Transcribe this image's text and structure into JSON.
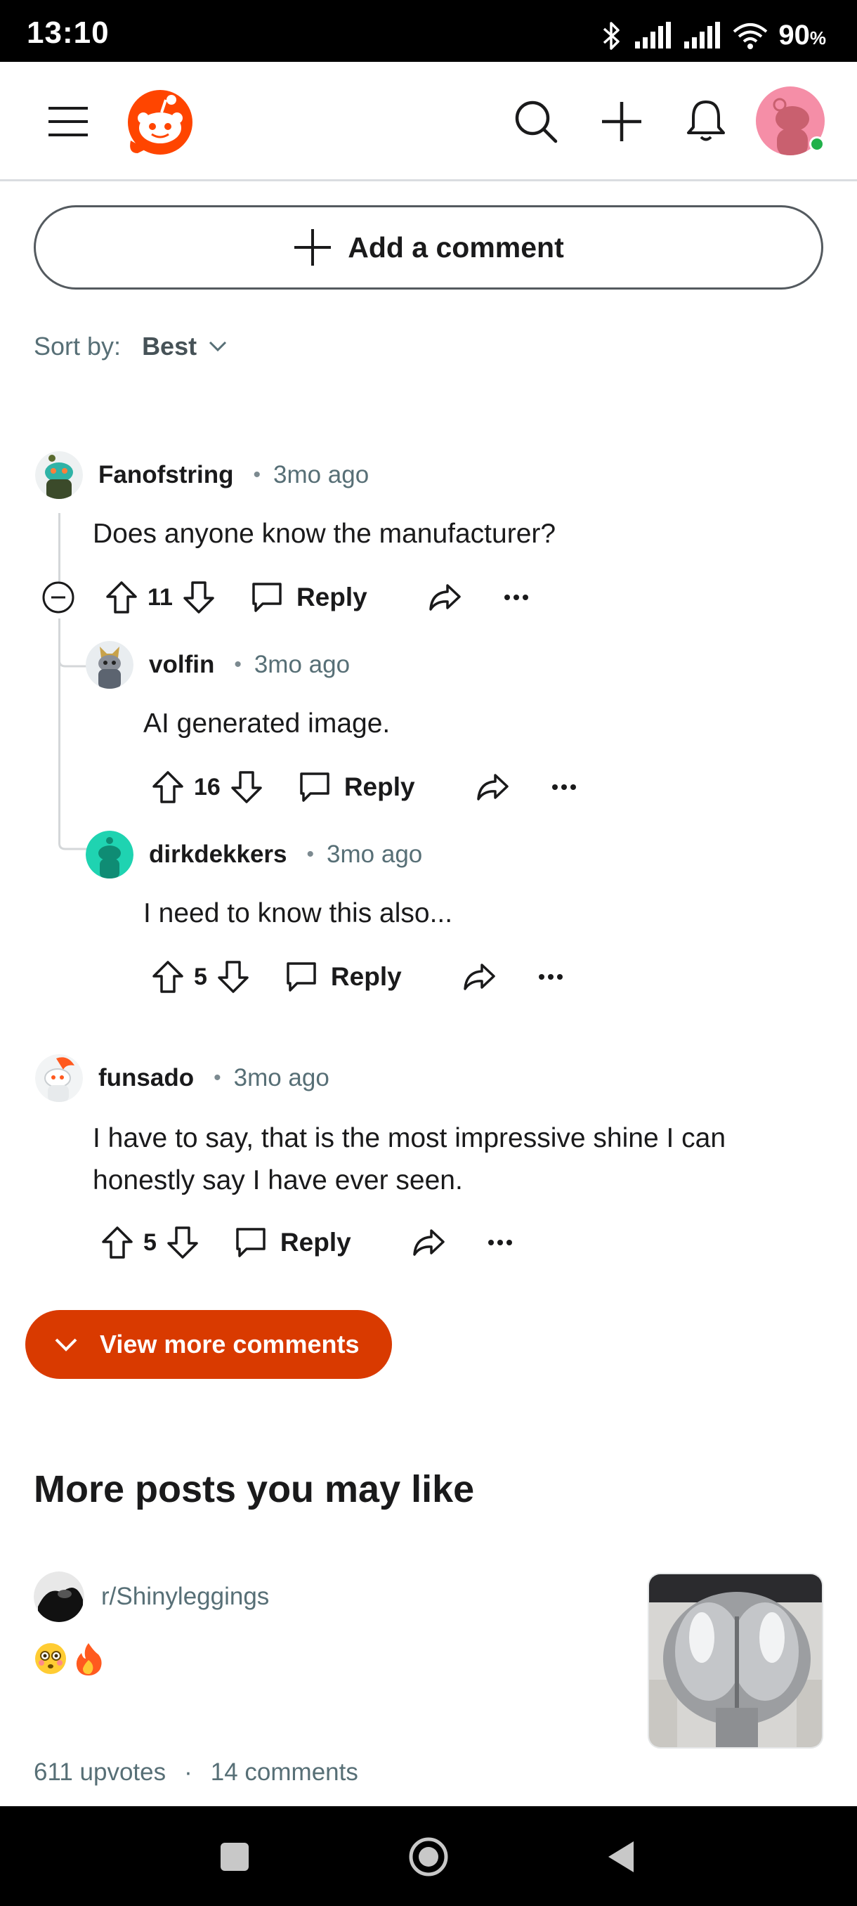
{
  "status_bar": {
    "time": "13:10",
    "battery": "90",
    "battery_unit": "%"
  },
  "header": {
    "menu_icon": "menu-icon",
    "logo": "reddit-logo",
    "search_icon": "search-icon",
    "create_icon": "plus-icon",
    "notifications_icon": "bell-icon"
  },
  "add_comment": {
    "label": "Add a comment"
  },
  "sort": {
    "label": "Sort by:",
    "value": "Best"
  },
  "comments": [
    {
      "author": "Fanofstring",
      "time": "3mo ago",
      "body": "Does anyone know the manufacturer?",
      "votes": "11",
      "reply": "Reply"
    },
    {
      "author": "volfin",
      "time": "3mo ago",
      "body": "AI generated image.",
      "votes": "16",
      "reply": "Reply"
    },
    {
      "author": "dirkdekkers",
      "time": "3mo ago",
      "body": "I need to know this also...",
      "votes": "5",
      "reply": "Reply"
    },
    {
      "author": "funsado",
      "time": "3mo ago",
      "body": "I have to say, that is the most impressive shine I can honestly say I have ever seen.",
      "votes": "5",
      "reply": "Reply"
    }
  ],
  "view_more": {
    "label": "View more comments"
  },
  "more_posts": {
    "title": "More posts you may like",
    "post": {
      "subreddit": "r/Shinyleggings",
      "body": "😳🔥",
      "upvotes": "611 upvotes",
      "separator": "·",
      "comments": "14 comments"
    }
  },
  "colors": {
    "accent": "#d93a00",
    "text": "#1a1a1b",
    "meta": "#576f76"
  }
}
